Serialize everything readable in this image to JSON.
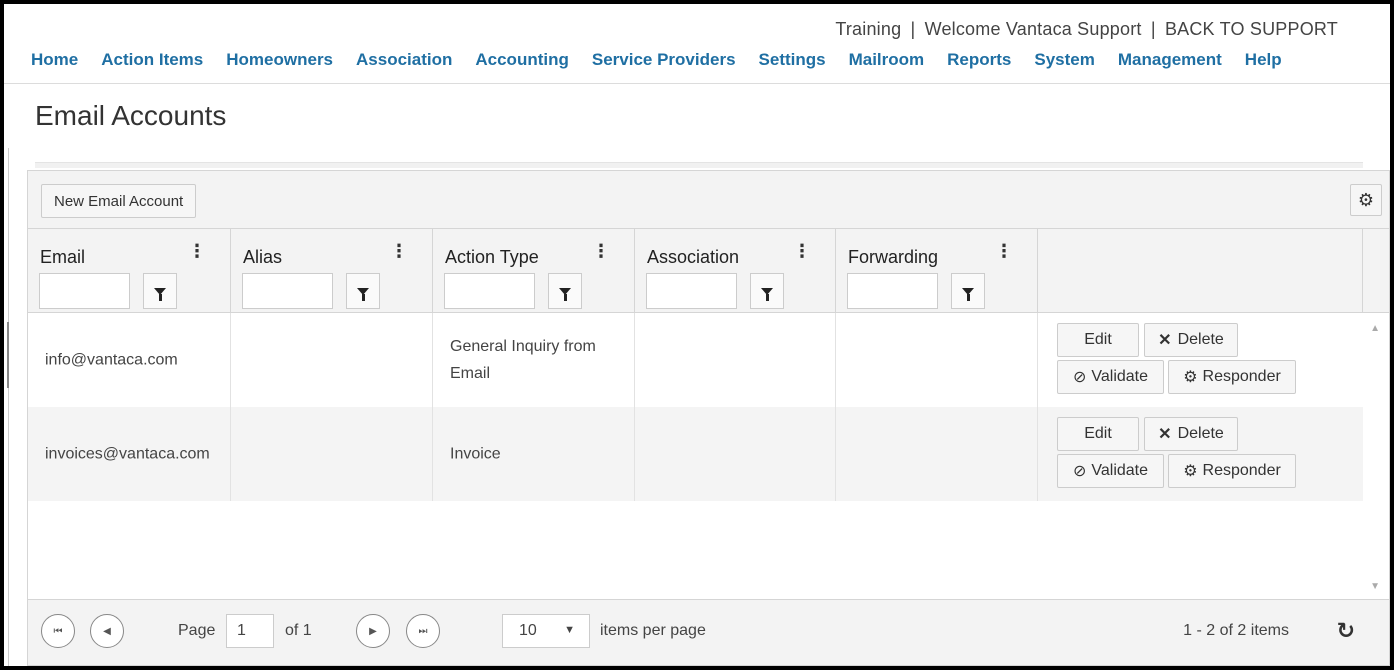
{
  "header": {
    "environment": "Training",
    "welcome": "Welcome Vantaca Support",
    "back_link": "BACK TO SUPPORT",
    "separator": "|"
  },
  "nav": [
    "Home",
    "Action Items",
    "Homeowners",
    "Association",
    "Accounting",
    "Service Providers",
    "Settings",
    "Mailroom",
    "Reports",
    "System",
    "Management",
    "Help"
  ],
  "page": {
    "title": "Email Accounts"
  },
  "toolbar": {
    "new_button": "New Email Account",
    "settings_icon": "gear-icon"
  },
  "columns": [
    {
      "label": "Email",
      "filter_value": ""
    },
    {
      "label": "Alias",
      "filter_value": ""
    },
    {
      "label": "Action Type",
      "filter_value": ""
    },
    {
      "label": "Association",
      "filter_value": ""
    },
    {
      "label": "Forwarding",
      "filter_value": ""
    }
  ],
  "rows": [
    {
      "email": "info@vantaca.com",
      "alias": "",
      "action_type": "General Inquiry from Email",
      "association": "",
      "forwarding": ""
    },
    {
      "email": "invoices@vantaca.com",
      "alias": "",
      "action_type": "Invoice",
      "association": "",
      "forwarding": ""
    }
  ],
  "row_actions": {
    "edit": "Edit",
    "delete": "Delete",
    "validate": "Validate",
    "responder": "Responder"
  },
  "pager": {
    "page_label": "Page",
    "page": "1",
    "of_label": "of 1",
    "page_size": "10",
    "items_per_page": "items per page",
    "summary": "1 - 2 of 2 items"
  }
}
